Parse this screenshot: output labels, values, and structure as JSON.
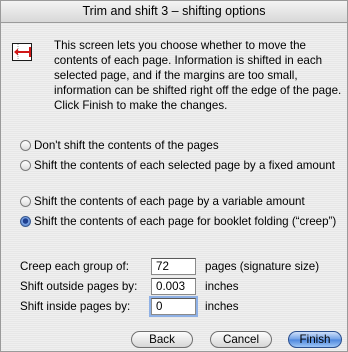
{
  "window": {
    "title": "Trim and shift 3 – shifting options"
  },
  "info": {
    "icon": "page-shift-icon",
    "text": "This screen lets you choose whether to move the contents of each page. Information is shifted in each selected page, and if the margins are too small, information can be shifted right off the edge of the page. Click Finish to make the changes."
  },
  "options": [
    {
      "label": "Don't shift the contents of the pages",
      "selected": false
    },
    {
      "label": "Shift the contents of each selected page by a fixed amount",
      "selected": false
    },
    {
      "label": "Shift the contents of each page by a variable amount",
      "selected": false
    },
    {
      "label": "Shift the contents of each page for booklet folding (“creep”)",
      "selected": true
    }
  ],
  "fields": {
    "creep": {
      "label": "Creep each group of:",
      "value": "72",
      "unit": "pages (signature size)"
    },
    "outside": {
      "label": "Shift outside pages by:",
      "value": "0.003",
      "unit": "inches"
    },
    "inside": {
      "label": "Shift inside pages by:",
      "value": "0",
      "unit": "inches"
    }
  },
  "buttons": {
    "back": "Back",
    "cancel": "Cancel",
    "finish": "Finish"
  },
  "colors": {
    "accent": "#4d86dd",
    "icon_red": "#d01818"
  }
}
